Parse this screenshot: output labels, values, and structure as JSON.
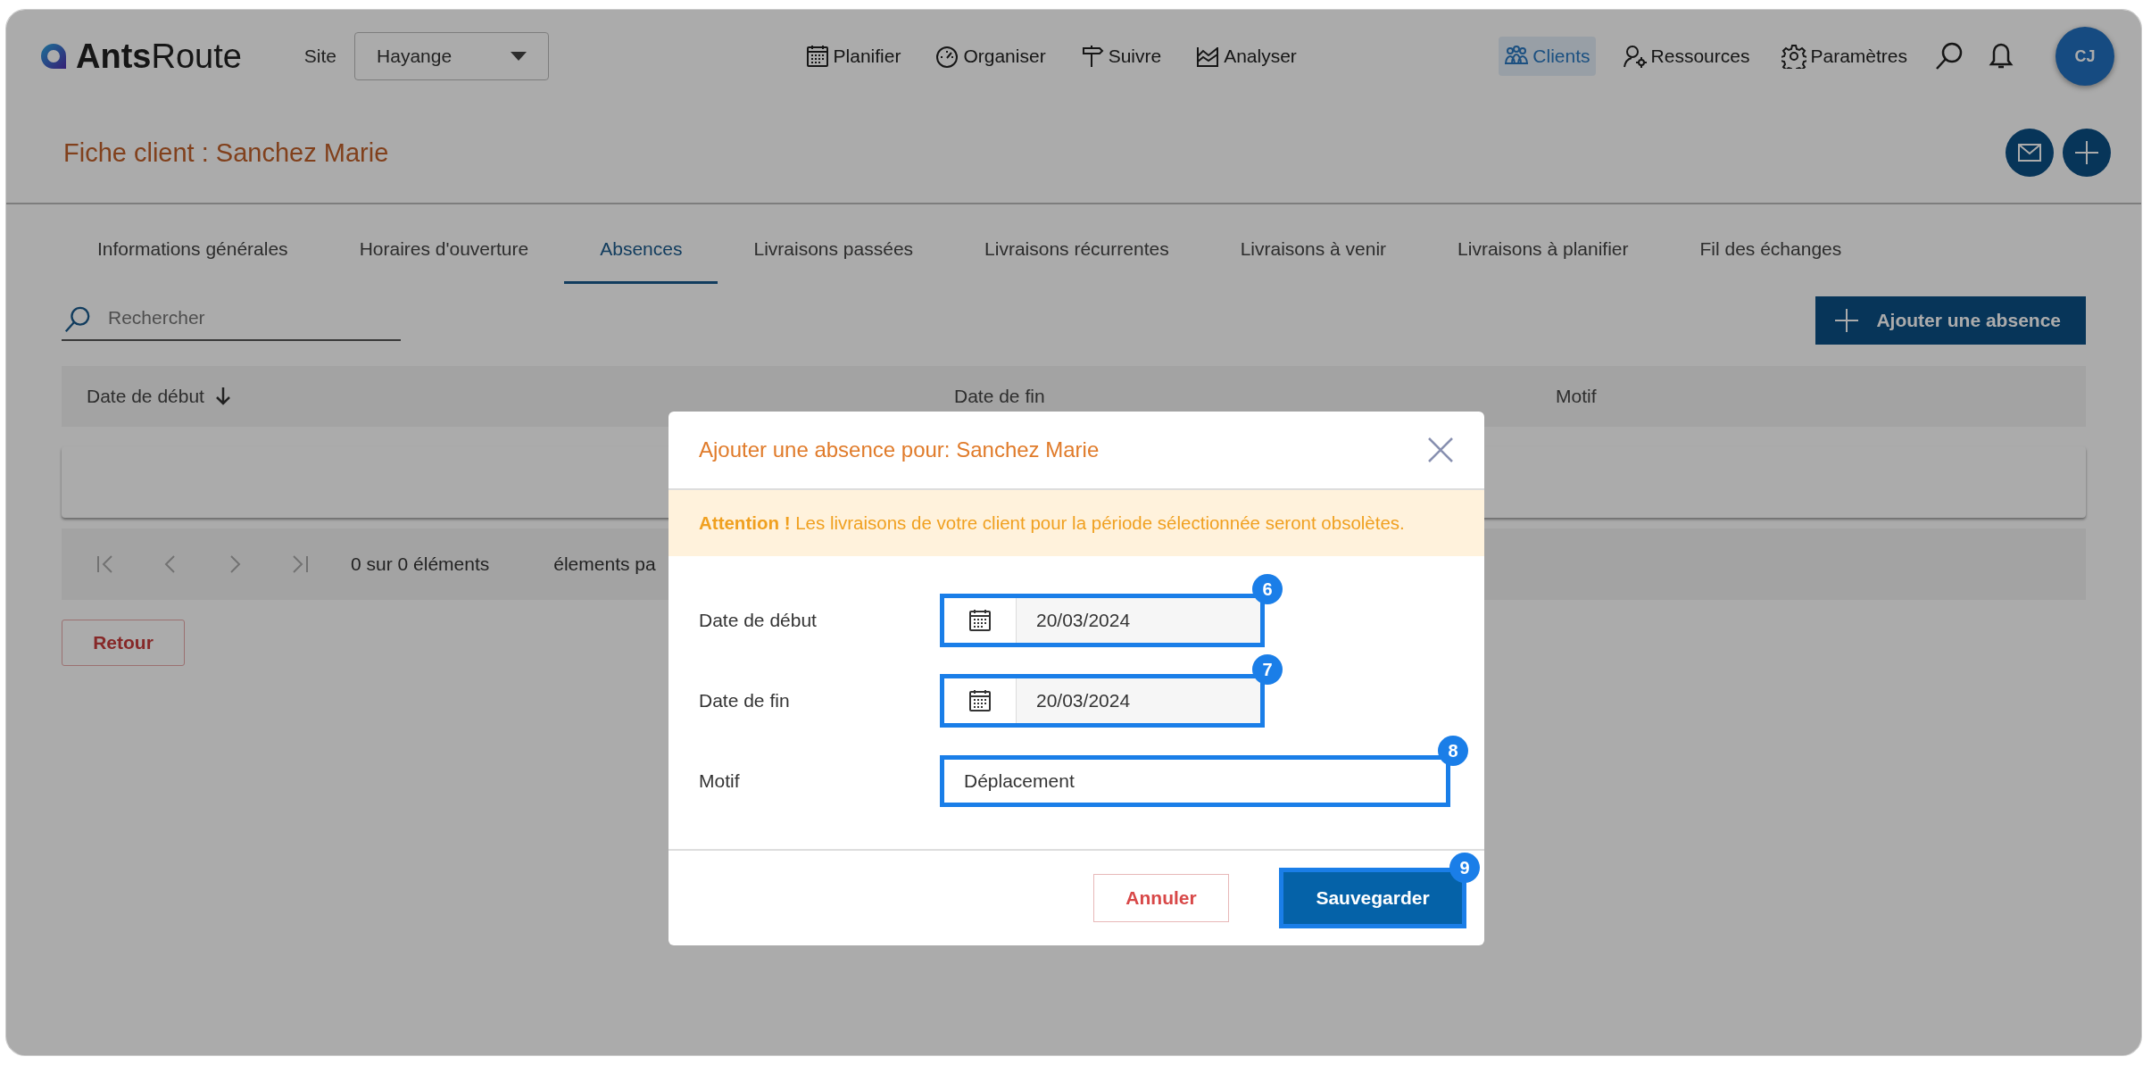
{
  "header": {
    "logo": {
      "strong": "Ants",
      "light": "Route"
    },
    "site_label": "Site",
    "site_select": {
      "value": "Hayange"
    },
    "nav": [
      {
        "label": "Planifier",
        "selected": false
      },
      {
        "label": "Organiser",
        "selected": false
      },
      {
        "label": "Suivre",
        "selected": false
      },
      {
        "label": "Analyser",
        "selected": false
      }
    ],
    "nav_right": [
      {
        "label": "Clients",
        "selected": true
      },
      {
        "label": "Ressources",
        "selected": false
      },
      {
        "label": "Paramètres",
        "selected": false
      }
    ],
    "avatar": "CJ"
  },
  "page": {
    "title": "Fiche client : Sanchez Marie"
  },
  "tabs": [
    {
      "label": "Informations générales",
      "selected": false
    },
    {
      "label": "Horaires d'ouverture",
      "selected": false
    },
    {
      "label": "Absences",
      "selected": true
    },
    {
      "label": "Livraisons passées",
      "selected": false
    },
    {
      "label": "Livraisons récurrentes",
      "selected": false
    },
    {
      "label": "Livraisons à venir",
      "selected": false
    },
    {
      "label": "Livraisons à planifier",
      "selected": false
    },
    {
      "label": "Fil des échanges",
      "selected": false
    }
  ],
  "search": {
    "placeholder": "Rechercher"
  },
  "add_button": "Ajouter une absence",
  "table": {
    "columns": [
      {
        "label": "Date de début",
        "sorted": true
      },
      {
        "label": "Date de fin",
        "sorted": false
      },
      {
        "label": "Motif",
        "sorted": false
      }
    ],
    "pagination": {
      "status": "0 sur 0 éléments",
      "per_page": "élements pa"
    }
  },
  "back_button": "Retour",
  "dialog": {
    "title": "Ajouter une absence pour: Sanchez Marie",
    "warning": "**Attention !** Les livraisons de votre client pour la période sélectionnée seront obsolètes.",
    "fields": [
      {
        "label": "Date de début",
        "kind": "date",
        "value": "20/03/2024",
        "callout": "6"
      },
      {
        "label": "Date de fin",
        "kind": "date",
        "value": "20/03/2024",
        "callout": "7"
      },
      {
        "label": "Motif",
        "kind": "text",
        "value": "Déplacement",
        "callout": "8"
      }
    ],
    "buttons": [
      {
        "label": "Annuler",
        "kind": "secondary"
      },
      {
        "label": "Sauvegarder",
        "kind": "primary",
        "callout": "9"
      }
    ]
  }
}
